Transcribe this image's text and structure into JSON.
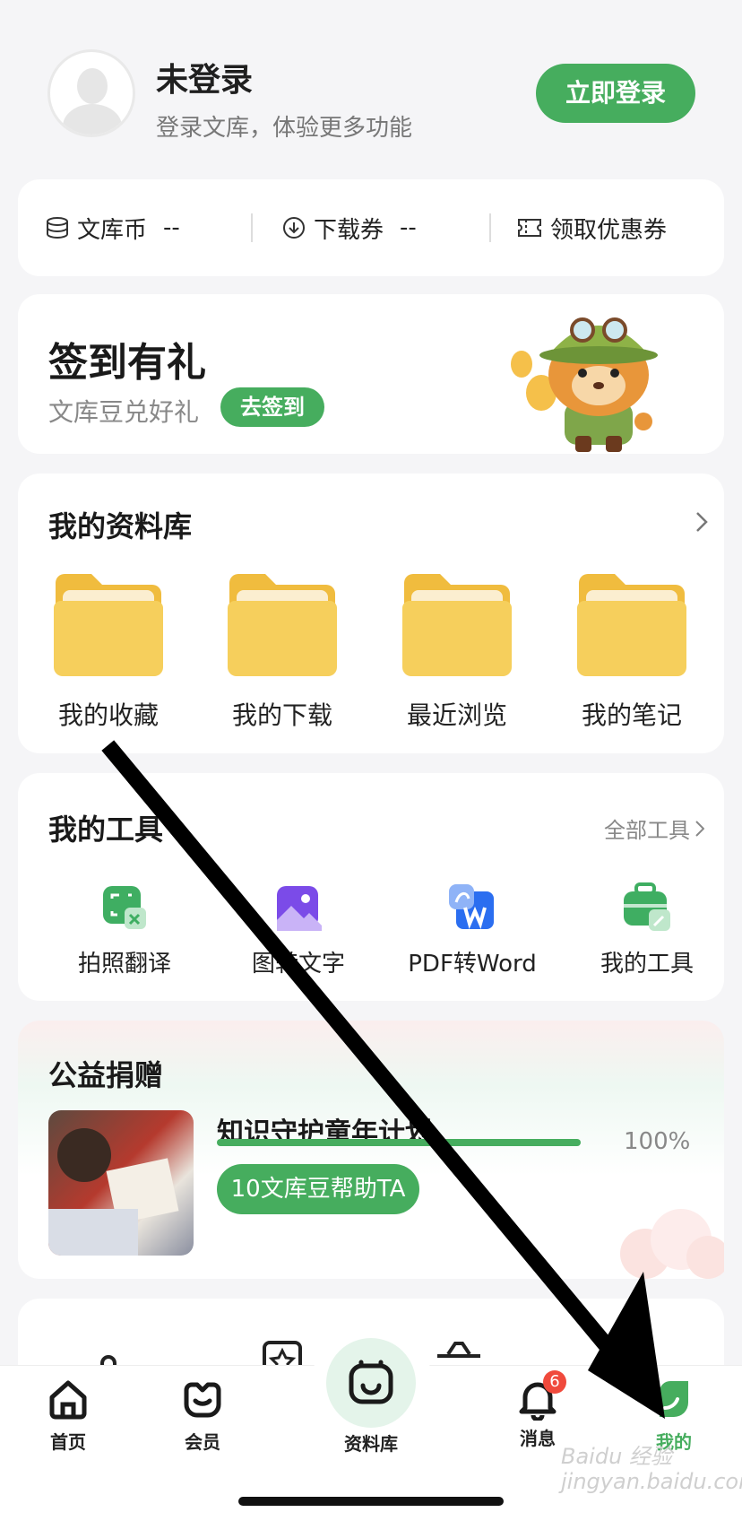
{
  "profile": {
    "name": "未登录",
    "subtitle": "登录文库，体验更多功能",
    "login_button": "立即登录"
  },
  "balance": {
    "coins_label": "文库币",
    "coins_value": "--",
    "tickets_label": "下载券",
    "tickets_value": "--",
    "coupon_label": "领取优惠券"
  },
  "signin": {
    "title": "签到有礼",
    "subtitle": "文库豆兑好礼",
    "button": "去签到"
  },
  "library": {
    "title": "我的资料库",
    "items": [
      {
        "label": "我的收藏"
      },
      {
        "label": "我的下载"
      },
      {
        "label": "最近浏览"
      },
      {
        "label": "我的笔记"
      }
    ]
  },
  "tools": {
    "title": "我的工具",
    "all_link": "全部工具",
    "items": [
      {
        "label": "拍照翻译",
        "icon": "photo-translate-icon"
      },
      {
        "label": "图转文字",
        "icon": "image-to-text-icon"
      },
      {
        "label": "PDF转Word",
        "icon": "pdf-to-word-icon"
      },
      {
        "label": "我的工具",
        "icon": "toolbox-icon"
      }
    ]
  },
  "charity": {
    "title": "公益捐赠",
    "project": "知识守护童年计划",
    "progress": 1.0,
    "progress_text": "100%",
    "button": "10文库豆帮助TA"
  },
  "tabbar": {
    "items": [
      {
        "label": "首页",
        "icon": "home-icon"
      },
      {
        "label": "会员",
        "icon": "vip-icon"
      },
      {
        "label": "资料库",
        "icon": "library-icon"
      },
      {
        "label": "消息",
        "icon": "bell-icon",
        "badge": "6"
      },
      {
        "label": "我的",
        "icon": "profile-icon",
        "active": true
      }
    ]
  },
  "colors": {
    "accent": "#46ad5e",
    "badge": "#f04a3c"
  },
  "watermark": "Baidu 经验 jingyan.baidu.com"
}
